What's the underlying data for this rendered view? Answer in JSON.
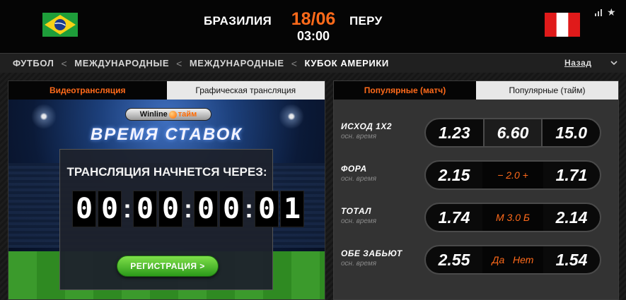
{
  "match": {
    "home_team": "БРАЗИЛИЯ",
    "away_team": "ПЕРУ",
    "date": "18/06",
    "time": "03:00"
  },
  "icons": {
    "stats": "bar-chart-icon",
    "favorite": "star-icon",
    "star_glyph": "★"
  },
  "breadcrumbs": [
    "ФУТБОЛ",
    "МЕЖДУНАРОДНЫЕ",
    "МЕЖДУНАРОДНЫЕ",
    "КУБОК АМЕРИКИ"
  ],
  "breadcrumb_separator": "<",
  "back_label": "Назад",
  "video": {
    "tabs": [
      "Видеотрансляция",
      "Графическая трансляция"
    ],
    "logo_brand": "Winline",
    "logo_suffix": "тайм",
    "bet_time_title": "ВРЕМЯ СТАВОК",
    "countdown_title": "ТРАНСЛЯЦИЯ НАЧНЕТСЯ ЧЕРЕЗ:",
    "countdown": [
      "0",
      "0",
      "0",
      "0",
      "0",
      "0",
      "0",
      "1"
    ],
    "colon": ":",
    "register_label": "РЕГИСТРАЦИЯ >"
  },
  "odds": {
    "tabs": [
      "Популярные (матч)",
      "Популярные (тайм)"
    ],
    "markets": [
      {
        "name": "ИСХОД 1X2",
        "sub": "осн. время",
        "values": [
          "1.23",
          "6.60",
          "15.0"
        ]
      },
      {
        "name": "ФОРА",
        "sub": "осн. время",
        "left": "2.15",
        "middle": "− 2.0 +",
        "right": "1.71"
      },
      {
        "name": "ТОТАЛ",
        "sub": "осн. время",
        "left": "1.74",
        "middle": "М 3.0 Б",
        "right": "2.14"
      },
      {
        "name": "ОБЕ ЗАБЬЮТ",
        "sub": "осн. время",
        "left": "2.55",
        "middle": "Да   Нет",
        "right": "1.54"
      }
    ]
  },
  "colors": {
    "accent": "#ff6a1a",
    "brazil_green": "#1e9e3a",
    "brazil_yellow": "#f7d117",
    "brazil_blue": "#1b3a8f",
    "peru_red": "#e01a1a",
    "button_green": "#3cb41e"
  }
}
